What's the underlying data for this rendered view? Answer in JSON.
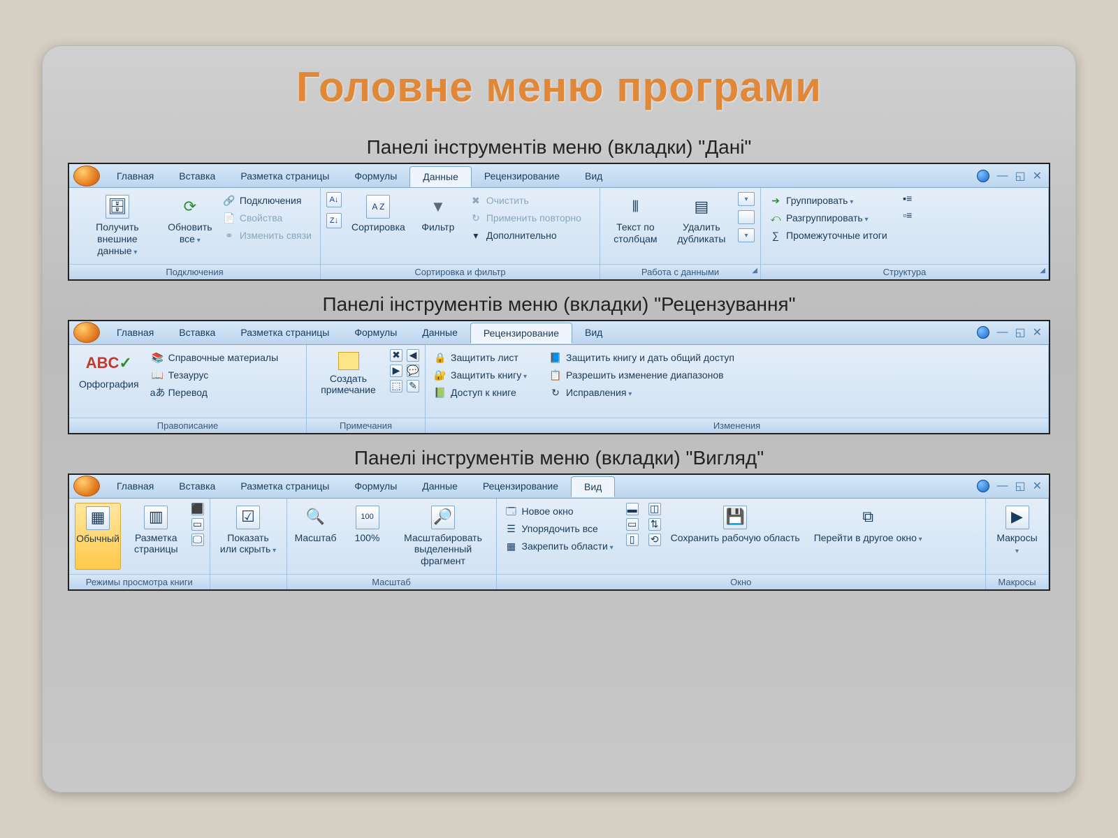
{
  "slide": {
    "title": "Головне меню програми",
    "captions": {
      "data": "Панелі інструментів меню (вкладки) \"Дані\"",
      "review": "Панелі інструментів меню (вкладки) \"Рецензування\"",
      "view": "Панелі інструментів меню (вкладки) \"Вигляд\""
    }
  },
  "tabs": {
    "home": "Главная",
    "insert": "Вставка",
    "layout": "Разметка страницы",
    "formulas": "Формулы",
    "data": "Данные",
    "review": "Рецензирование",
    "view": "Вид"
  },
  "ribbon_data": {
    "groups": {
      "connections": {
        "label": "Подключения",
        "get_external": "Получить внешние данные",
        "refresh_all": "Обновить все",
        "connections": "Подключения",
        "properties": "Свойства",
        "edit_links": "Изменить связи"
      },
      "sort_filter": {
        "label": "Сортировка и фильтр",
        "sort": "Сортировка",
        "filter": "Фильтр",
        "clear": "Очистить",
        "reapply": "Применить повторно",
        "advanced": "Дополнительно"
      },
      "data_tools": {
        "label": "Работа с данными",
        "text_to_cols": "Текст по столбцам",
        "remove_dupes": "Удалить дубликаты"
      },
      "outline": {
        "label": "Структура",
        "group": "Группировать",
        "ungroup": "Разгруппировать",
        "subtotal": "Промежуточные итоги"
      }
    }
  },
  "ribbon_review": {
    "groups": {
      "proofing": {
        "label": "Правописание",
        "spelling": "Орфография",
        "research": "Справочные материалы",
        "thesaurus": "Тезаурус",
        "translate": "Перевод"
      },
      "comments": {
        "label": "Примечания",
        "new_comment": "Создать примечание"
      },
      "changes": {
        "label": "Изменения",
        "protect_sheet": "Защитить лист",
        "protect_book": "Защитить книгу",
        "share_book": "Доступ к книге",
        "protect_share": "Защитить книгу и дать общий доступ",
        "allow_ranges": "Разрешить изменение диапазонов",
        "track": "Исправления"
      }
    }
  },
  "ribbon_view": {
    "statusbar": "Режимы просмотра книги",
    "groups": {
      "views": {
        "normal": "Обычный",
        "page_layout": "Разметка страницы"
      },
      "show_hide": {
        "label": "",
        "show_hide": "Показать или скрыть"
      },
      "zoom": {
        "label": "Масштаб",
        "zoom": "Масштаб",
        "hundred": "100%",
        "zoom_sel": "Масштабировать выделенный фрагмент"
      },
      "window": {
        "label": "Окно",
        "new_window": "Новое окно",
        "arrange": "Упорядочить все",
        "freeze": "Закрепить области",
        "save_ws": "Сохранить рабочую область",
        "switch": "Перейти в другое окно"
      },
      "macros": {
        "label": "Макросы",
        "macros": "Макросы"
      }
    }
  }
}
